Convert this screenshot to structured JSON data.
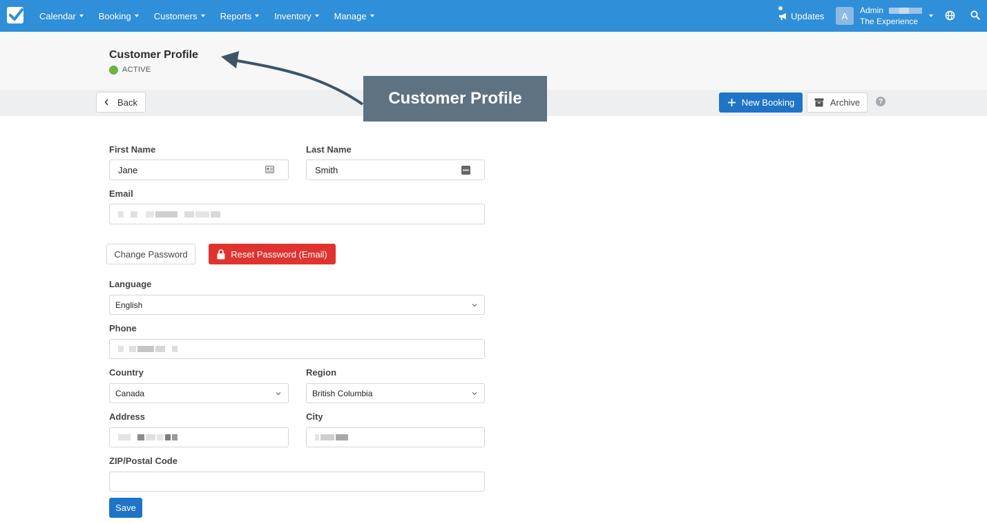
{
  "nav": {
    "items": [
      "Calendar",
      "Booking",
      "Customers",
      "Reports",
      "Inventory",
      "Manage"
    ],
    "updates_label": "Updates",
    "avatar_initial": "A",
    "user_name": "Admin",
    "company": "The Experience"
  },
  "header": {
    "title": "Customer Profile",
    "status": "ACTIVE"
  },
  "toolbar": {
    "back_label": "Back",
    "new_booking_label": "New Booking",
    "archive_label": "Archive",
    "help_label": "?"
  },
  "callout": {
    "text": "Customer Profile"
  },
  "form": {
    "first_name_label": "First Name",
    "first_name_value": "Jane",
    "last_name_label": "Last Name",
    "last_name_value": "Smith",
    "email_label": "Email",
    "change_password_label": "Change Password",
    "reset_password_label": "Reset Password (Email)",
    "language_label": "Language",
    "language_value": "English",
    "phone_label": "Phone",
    "country_label": "Country",
    "country_value": "Canada",
    "region_label": "Region",
    "region_value": "British Columbia",
    "address_label": "Address",
    "city_label": "City",
    "zip_label": "ZIP/Postal Code",
    "zip_value": "",
    "save_label": "Save"
  },
  "colors": {
    "nav": "#2f8fd8",
    "primary_button": "#1f74c7",
    "danger_button": "#e0332f",
    "status_active": "#6db33f",
    "callout": "#5e7282"
  }
}
